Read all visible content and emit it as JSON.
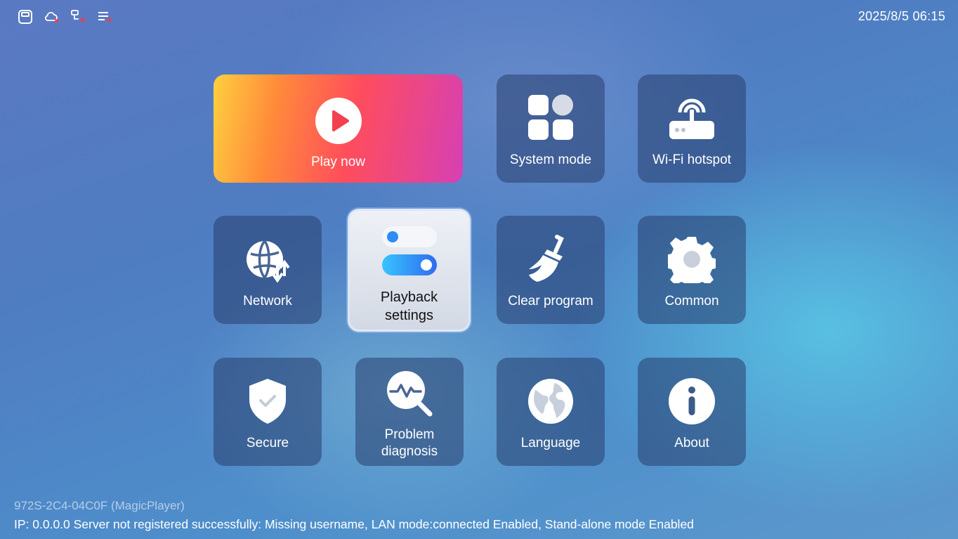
{
  "status_bar": {
    "icons": [
      "storage-icon",
      "cloud-disconnected-icon",
      "sync-error-icon",
      "list-error-icon"
    ],
    "datetime": "2025/8/5 06:15"
  },
  "tiles": {
    "play_now": "Play now",
    "system_mode": "System mode",
    "wifi_hotspot": "Wi-Fi hotspot",
    "network": "Network",
    "playback_settings_1": "Playback",
    "playback_settings_2": "settings",
    "clear_program": "Clear program",
    "common": "Common",
    "secure": "Secure",
    "problem_diagnosis_1": "Problem",
    "problem_diagnosis_2": "diagnosis",
    "language": "Language",
    "about": "About"
  },
  "footer": {
    "device": "972S-2C4-04C0F (MagicPlayer)",
    "status": "IP: 0.0.0.0  Server not registered successfully: Missing username, LAN mode:connected Enabled, Stand-alone mode Enabled"
  },
  "colors": {
    "error_red": "#e8404a",
    "play_gradient": [
      "#ffcf3f",
      "#ff4d5c",
      "#d640b4"
    ],
    "toggle_blue": "#2f8cf5"
  }
}
